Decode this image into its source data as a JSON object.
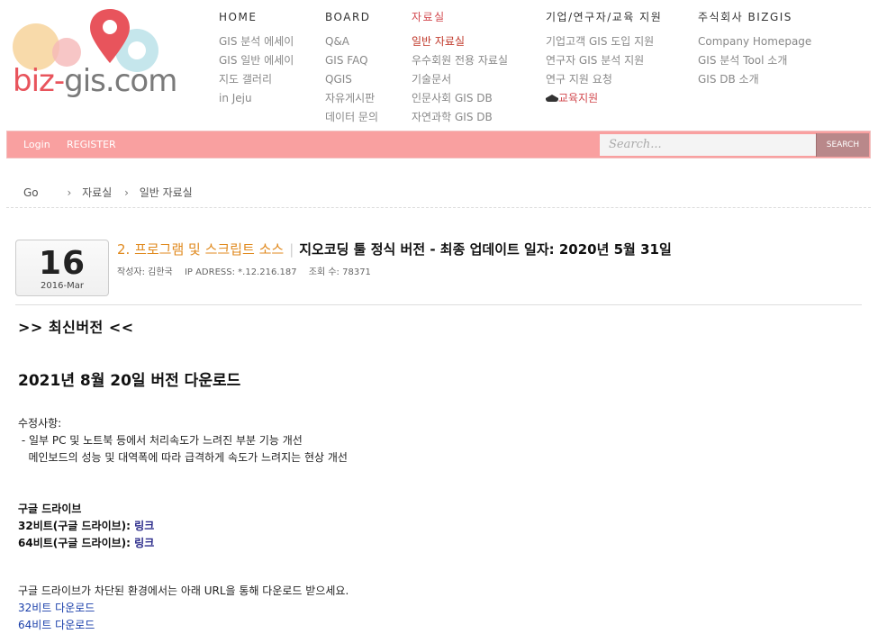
{
  "logo": {
    "text_red": "biz-",
    "text_gray": "gis.com"
  },
  "menu": [
    {
      "head": "HOME",
      "items": [
        "GIS 분석 에세이",
        "GIS 일반 에세이",
        "지도 갤러리",
        "in Jeju"
      ]
    },
    {
      "head": "BOARD",
      "items": [
        "Q&A",
        "GIS FAQ",
        "QGIS",
        "자유게시판",
        "데이터 문의"
      ]
    },
    {
      "head": "자료실",
      "items": [
        "일반 자료실",
        "우수회원 전용 자료실",
        "기술문서",
        "인문사회 GIS DB",
        "자연과학 GIS DB"
      ]
    },
    {
      "head": "기업/연구자/교육 지원",
      "items": [
        "기업고객 GIS 도입 지원",
        "연구자 GIS 분석 지원",
        "연구 지원 요청",
        "교육지원"
      ]
    },
    {
      "head": "주식회사 BIZGIS",
      "items": [
        "Company Homepage",
        "GIS 분석 Tool 소개",
        "GIS DB 소개"
      ]
    }
  ],
  "bar": {
    "login": "Login",
    "register": "REGISTER",
    "search_placeholder": "Search...",
    "search_button": "SEARCH"
  },
  "breadcrumb": {
    "home": "Go",
    "level1": "자료실",
    "level2": "일반 자료실"
  },
  "post": {
    "day": "16",
    "year_month": "2016-Mar",
    "category": "2. 프로그램 및 스크립트 소스",
    "title": "지오코딩 툴 정식 버전 - 최종 업데이트 일자: 2020년 5월 31일",
    "author": "작성자: 김한국",
    "ip": "IP ADRESS: *.12.216.187",
    "views": "조회 수: 78371"
  },
  "content": {
    "latest": ">> 최신버전 <<",
    "version": "2021년 8월 20일 버전 다운로드",
    "changes_label": "수정사항:",
    "change_1": " - 일부 PC 및 노트북 등에서 처리속도가 느려진 부분 기능 개선",
    "change_2": "   메인보드의 성능 및 대역폭에 따라 급격하게 속도가 느려지는 현상 개선",
    "gdrive_title": "구글 드라이브",
    "gdrive_32_label": "32비트(구글 드라이브): ",
    "gdrive_64_label": "64비트(구글 드라이브): ",
    "link_text": "링크",
    "blocked_note": "구글 드라이브가 차단된 환경에서는 아래 URL을 통해 다운로드 받으세요.",
    "dl_32": "32비트 다운로드",
    "dl_64": "64비트 다운로드"
  }
}
